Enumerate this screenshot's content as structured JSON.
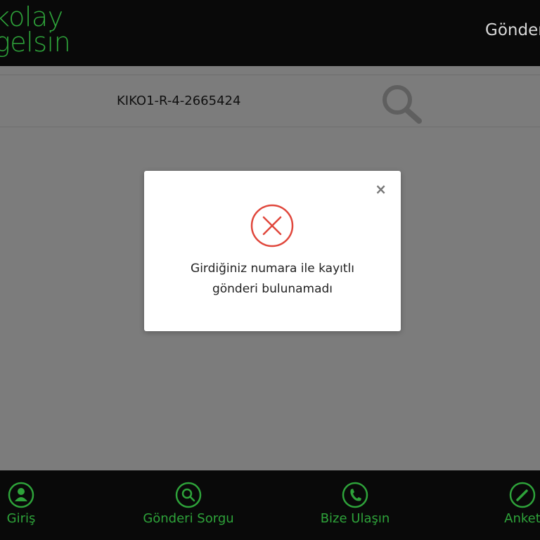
{
  "header": {
    "logo_line1": "kolay",
    "logo_line2": "gelsin",
    "nav_link": "Gönder"
  },
  "search": {
    "tracking_number": "KIKO1-R-4-2665424",
    "icon": "search-icon"
  },
  "dialog": {
    "close_label": "×",
    "icon": "error-x-circle-icon",
    "message_line1": "Girdiğiniz numara ile kayıtlı",
    "message_line2": "gönderi bulunamadı"
  },
  "footer": {
    "tabs": [
      {
        "label": "Giriş",
        "icon": "user-icon"
      },
      {
        "label": "Gönderi Sorgu",
        "icon": "search-icon"
      },
      {
        "label": "Bize Ulaşın",
        "icon": "phone-icon"
      },
      {
        "label": "Anket",
        "icon": "pencil-icon"
      }
    ]
  },
  "colors": {
    "brand_green": "#2ea33a",
    "header_bg": "#090909",
    "overlay_bg": "#7c7c7c",
    "error_red": "#e0473c"
  }
}
